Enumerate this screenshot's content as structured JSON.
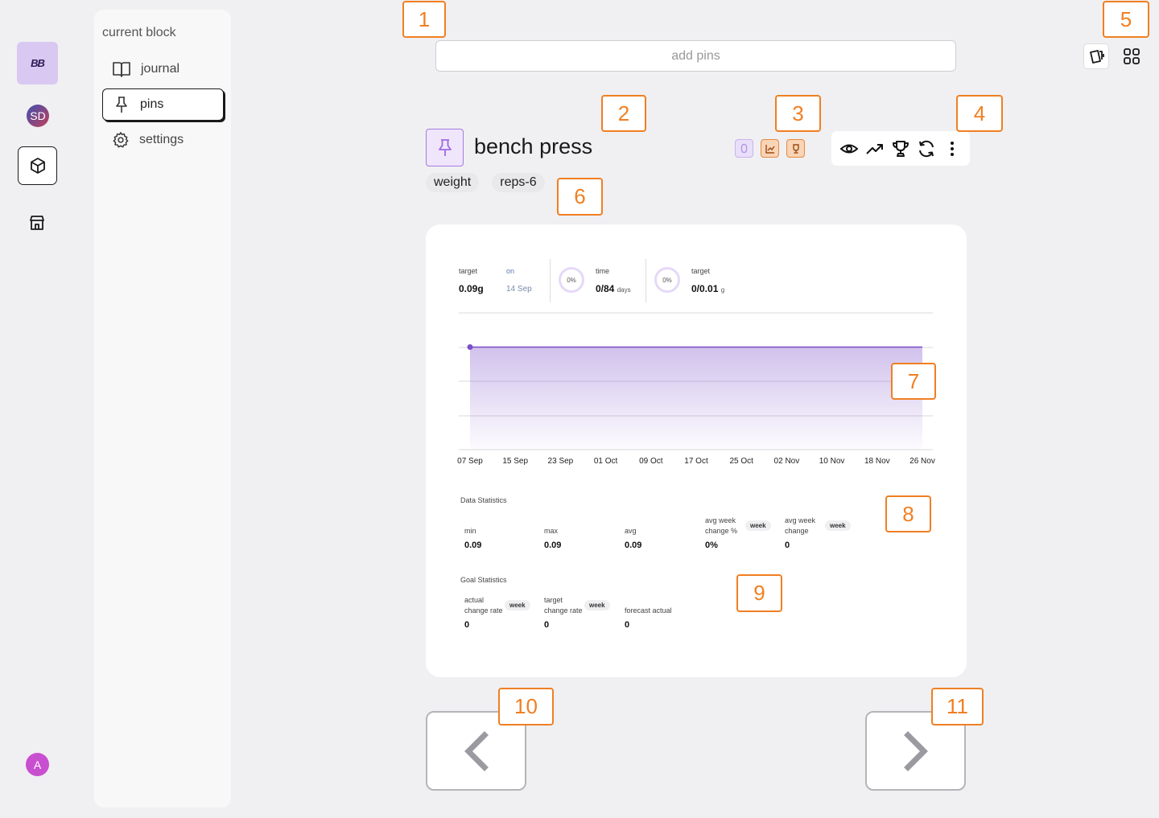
{
  "rail": {
    "logo_text": "BB",
    "workspace_initials": "SD",
    "user_initial": "A"
  },
  "sidenav": {
    "title": "current block",
    "items": [
      {
        "label": "journal",
        "icon": "book-icon"
      },
      {
        "label": "pins",
        "icon": "pin-icon",
        "active": true
      },
      {
        "label": "settings",
        "icon": "gear-icon"
      }
    ]
  },
  "header": {
    "add_pins_placeholder": "add pins"
  },
  "pin": {
    "title": "bench press",
    "tags": [
      "weight",
      "reps-6"
    ],
    "badges": [
      "ring-badge-icon",
      "chart-badge-icon",
      "trophy-badge-icon"
    ],
    "actions": [
      "eye-icon",
      "trend-icon",
      "trophy-icon",
      "refresh-icon",
      "more-icon"
    ]
  },
  "summary": {
    "target_label": "target",
    "target_value": "0.09g",
    "on_label": "on",
    "on_value": "14 Sep",
    "time_ring": "0%",
    "time_label": "time",
    "time_value": "0/84",
    "time_unit": "days",
    "target2_ring": "0%",
    "target2_label": "target",
    "target2_value": "0/0.01",
    "target2_unit": "g"
  },
  "chart_data": {
    "type": "area",
    "x": [
      "07 Sep",
      "15 Sep",
      "23 Sep",
      "01 Oct",
      "09 Oct",
      "17 Oct",
      "25 Oct",
      "02 Nov",
      "10 Nov",
      "18 Nov",
      "26 Nov"
    ],
    "series": [
      {
        "values": [
          0.09,
          0.09,
          0.09,
          0.09,
          0.09,
          0.09,
          0.09,
          0.09,
          0.09,
          0.09,
          0.09
        ]
      }
    ],
    "ylim": [
      0,
      0.12
    ],
    "grid": true,
    "color": "#7b4fc9"
  },
  "data_statistics": {
    "title": "Data Statistics",
    "min_label": "min",
    "min_value": "0.09",
    "max_label": "max",
    "max_value": "0.09",
    "avg_label": "avg",
    "avg_value": "0.09",
    "awcp_label_1": "avg week",
    "awcp_label_2": "change %",
    "awcp_value": "0%",
    "awcp_badge": "week",
    "awc_label_1": "avg week",
    "awc_label_2": "change",
    "awc_value": "0",
    "awc_badge": "week"
  },
  "goal_statistics": {
    "title": "Goal Statistics",
    "acr_label_1": "actual",
    "acr_label_2": "change rate",
    "acr_value": "0",
    "acr_badge": "week",
    "tcr_label_1": "target",
    "tcr_label_2": "change rate",
    "tcr_value": "0",
    "tcr_badge": "week",
    "fa_label": "forecast actual",
    "fa_value": "0"
  },
  "annotations": [
    "1",
    "2",
    "3",
    "4",
    "5",
    "6",
    "7",
    "8",
    "9",
    "10",
    "11"
  ],
  "colors": {
    "accent": "#7b4fc9",
    "annotation": "#f07f22"
  }
}
